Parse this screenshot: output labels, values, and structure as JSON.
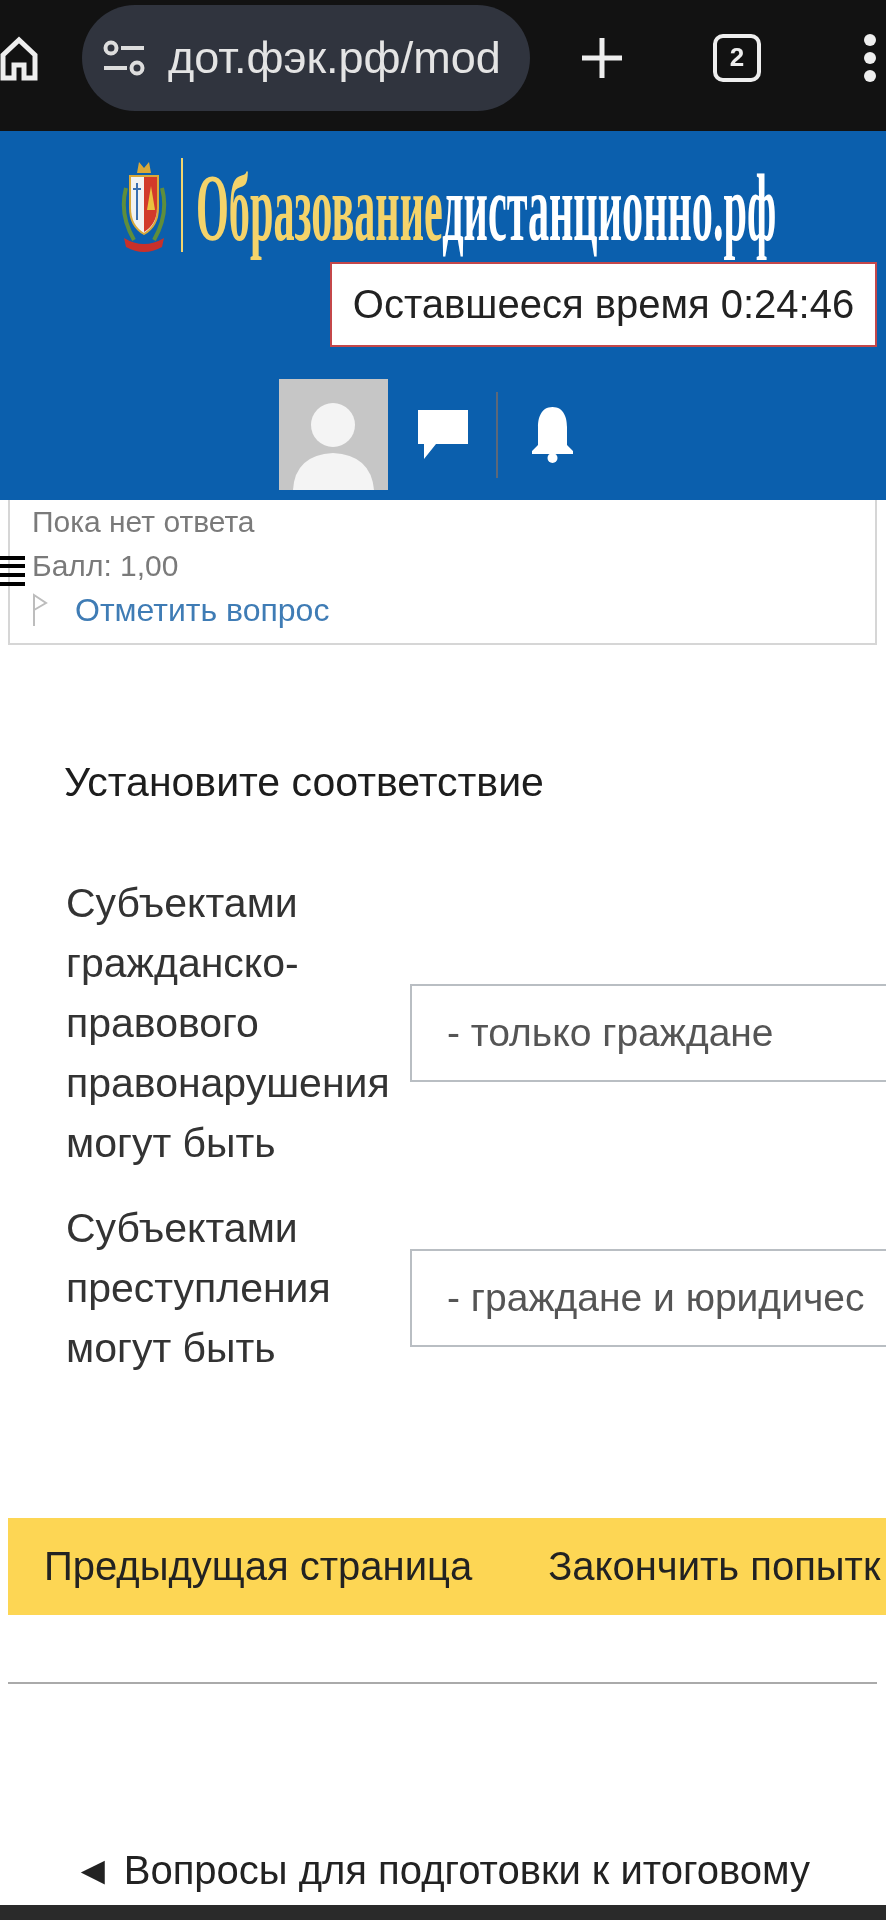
{
  "browser": {
    "url": "дот.фэк.рф/mod",
    "tab_count": "2"
  },
  "header": {
    "logo": [
      {
        "kind": "accent",
        "text": "Образование"
      },
      {
        "kind": "plain",
        "text": "дистанционно.рф"
      }
    ],
    "timer": "Оставшееся время 0:24:46"
  },
  "question_info": {
    "status": "Пока нет ответа",
    "grade": "Балл: 1,00",
    "flag_link": "Отметить вопрос",
    "flagged": false
  },
  "question": {
    "prompt": "Установите соответствие",
    "pairs": [
      {
        "stem": "Субъектами гражданско-правового правонарушения могут быть",
        "answer": "- только граждане"
      },
      {
        "stem": "Субъектами преступления могут быть",
        "answer": "- граждане и юридичес"
      }
    ]
  },
  "navigation_buttons": [
    {
      "label": "Предыдущая страница"
    },
    {
      "label": "Закончить попытк"
    }
  ],
  "footer": {
    "previous_activity_link": "◄ Вопросы для подготовки к итоговому"
  }
}
